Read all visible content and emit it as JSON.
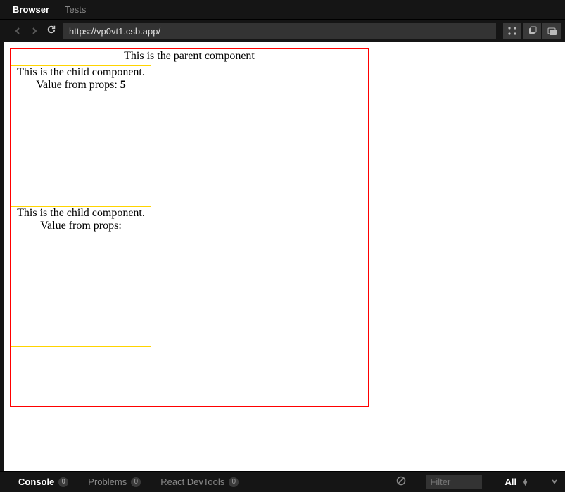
{
  "tabs": {
    "browser": "Browser",
    "tests": "Tests"
  },
  "url": "https://vp0vt1.csb.app/",
  "preview": {
    "parentTitle": "This is the parent component",
    "childLine1": "This is the child component.",
    "childValueLabel": "Value from props: ",
    "child1Value": "5",
    "child2Value": ""
  },
  "console": {
    "consoleLabel": "Console",
    "consoleCount": "0",
    "problemsLabel": "Problems",
    "problemsCount": "0",
    "devtoolsLabel": "React DevTools",
    "devtoolsCount": "0",
    "filterPlaceholder": "Filter",
    "levelLabel": "All"
  }
}
